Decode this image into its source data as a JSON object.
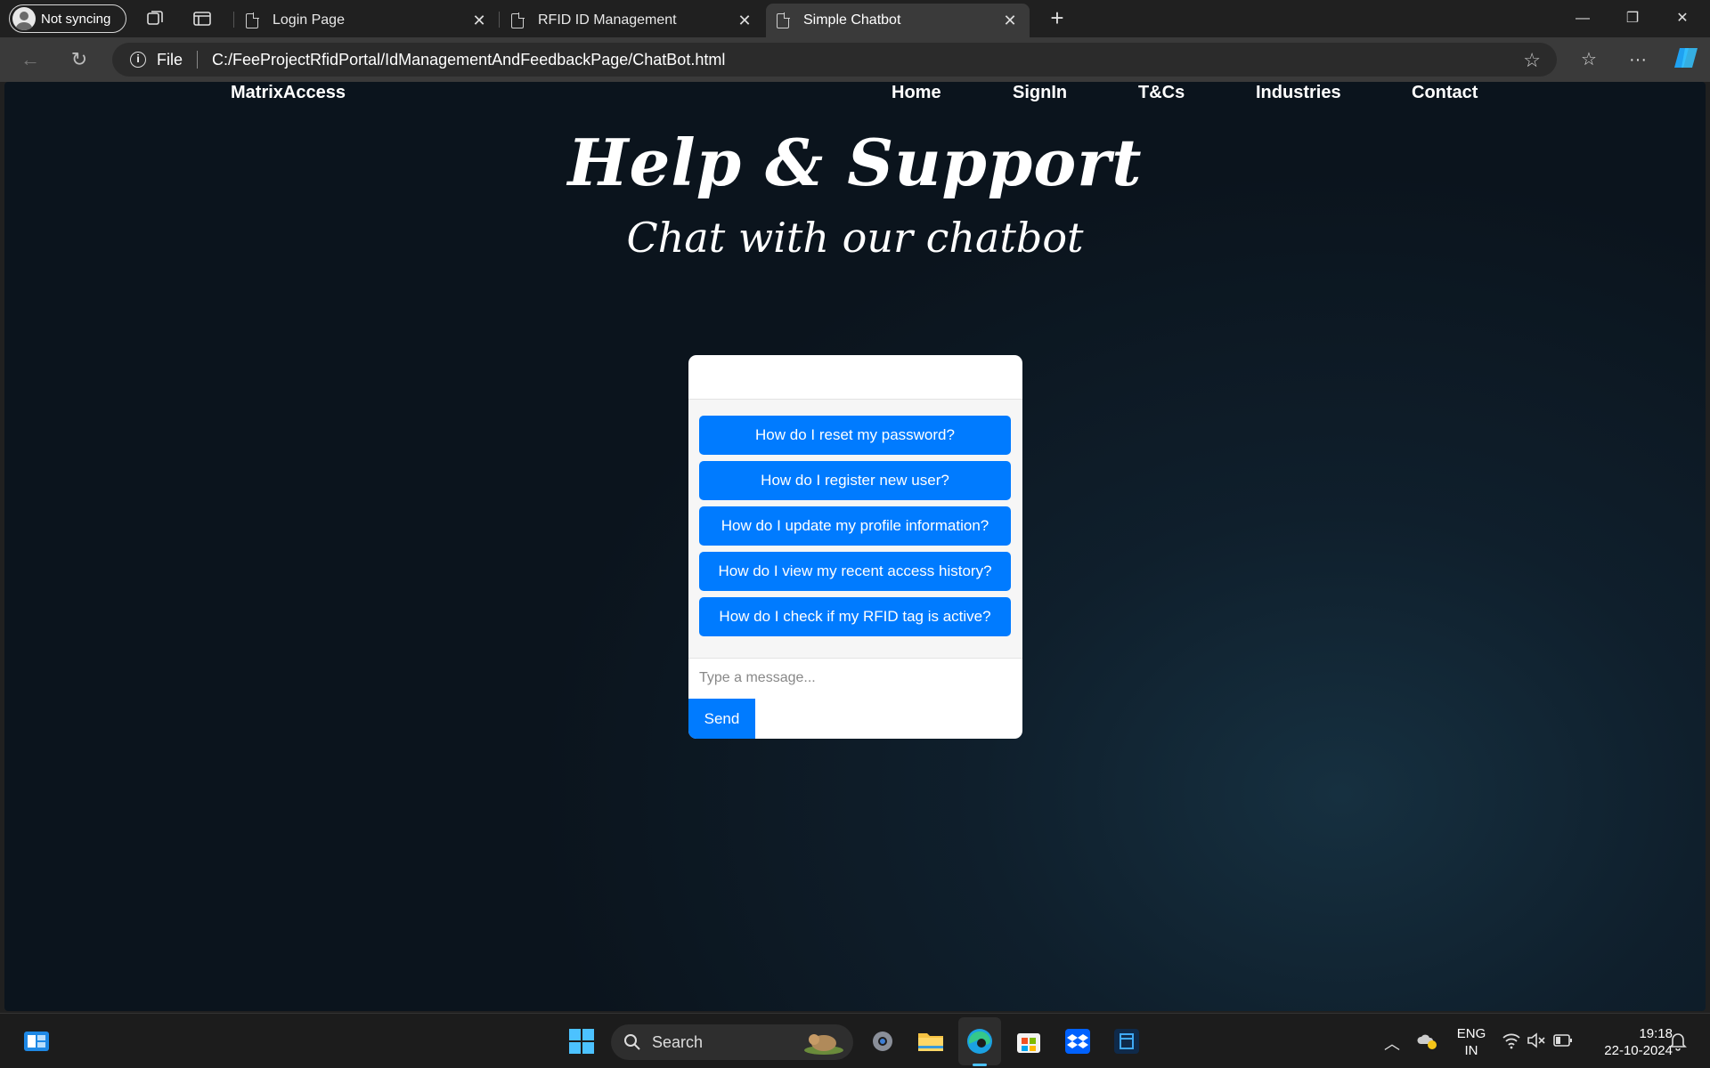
{
  "browser": {
    "profile_label": "Not syncing",
    "tabs": [
      {
        "title": "Login Page",
        "active": false
      },
      {
        "title": "RFID ID Management",
        "active": false
      },
      {
        "title": "Simple Chatbot",
        "active": true
      }
    ],
    "address": {
      "scheme_label": "File",
      "url": "C:/FeeProjectRfidPortal/IdManagementAndFeedbackPage/ChatBot.html"
    },
    "close_glyph": "✕",
    "new_tab_glyph": "+",
    "window_controls": {
      "minimize": "—",
      "restore": "❐",
      "close": "✕"
    },
    "nav": {
      "back": "←",
      "refresh": "↻",
      "favorite": "☆",
      "favorites_bar": "☆",
      "more": "···"
    }
  },
  "site": {
    "brand": "MatrixAccess",
    "nav_links": [
      "Home",
      "SignIn",
      "T&Cs",
      "Industries",
      "Contact"
    ],
    "hero_title": "Help & Support",
    "hero_subtitle": "Chat with our chatbot"
  },
  "chatbot": {
    "options": [
      "How do I reset my password?",
      "How do I register new user?",
      "How do I update my profile information?",
      "How do I view my recent access history?",
      "How do I check if my RFID tag is active?"
    ],
    "input_placeholder": "Type a message...",
    "send_label": "Send",
    "accent_color": "#007bff"
  },
  "taskbar": {
    "search_label": "Search",
    "language": {
      "line1": "ENG",
      "line2": "IN"
    },
    "clock": {
      "time": "19:18",
      "date": "22-10-2024"
    },
    "icons": [
      "widgets-icon",
      "start-icon",
      "search-icon",
      "settings-icon",
      "file-explorer-icon",
      "edge-icon",
      "store-icon",
      "dropbox-icon",
      "app-icon"
    ]
  }
}
